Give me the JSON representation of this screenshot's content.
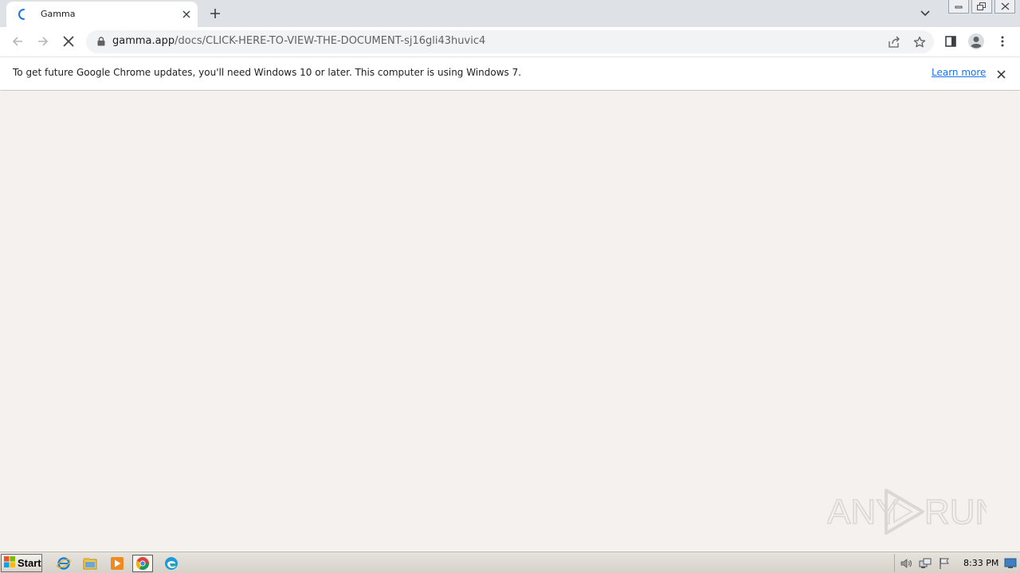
{
  "tab": {
    "title": "Gamma"
  },
  "toolbar": {
    "url_host": "gamma.app",
    "url_path": "/docs/CLICK-HERE-TO-VIEW-THE-DOCUMENT-sj16gli43huvic4"
  },
  "infobar": {
    "message": "To get future Google Chrome updates, you'll need Windows 10 or later. This computer is using Windows 7.",
    "link_label": "Learn more"
  },
  "watermark": {
    "text_left": "ANY",
    "text_right": "RUN"
  },
  "taskbar": {
    "start_label": "Start",
    "clock": "8:33 PM"
  },
  "colors": {
    "page_background": "#f4f1ee",
    "tabstrip": "#dee1e6",
    "link": "#1a73e8",
    "accent_blue": "#1a73e8"
  },
  "icons": {
    "tab": [
      "loading-spinner-icon",
      "close-icon",
      "plus-icon",
      "chevron-down-icon"
    ],
    "toolbar": [
      "back-arrow-icon",
      "forward-arrow-icon",
      "stop-icon",
      "lock-icon",
      "share-icon",
      "star-icon",
      "side-panel-icon",
      "profile-icon",
      "kebab-menu-icon"
    ],
    "taskbar": [
      "windows-logo-icon",
      "internet-explorer-icon",
      "file-explorer-icon",
      "media-player-icon",
      "chrome-icon",
      "edge-icon",
      "speaker-icon",
      "network-icon",
      "flag-icon",
      "show-desktop-icon"
    ]
  }
}
